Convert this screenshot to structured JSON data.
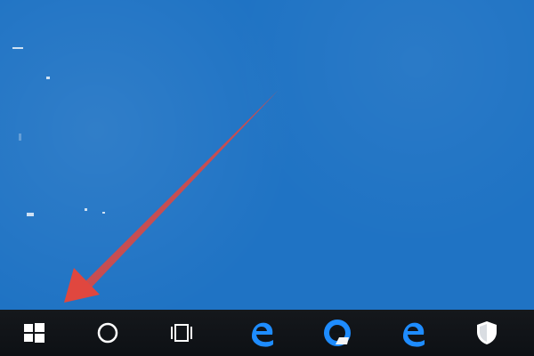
{
  "desktop": {
    "background_color": "#1f73c4",
    "annotation_color": "#e0473f"
  },
  "taskbar": {
    "background_color": "#111419",
    "items": [
      {
        "icon": "windows-logo-icon"
      },
      {
        "icon": "search-circle-icon"
      },
      {
        "icon": "task-view-icon"
      },
      {
        "icon": "edge-icon"
      },
      {
        "icon": "edge-icon"
      },
      {
        "icon": "edge-icon"
      },
      {
        "icon": "shield-icon"
      }
    ]
  }
}
